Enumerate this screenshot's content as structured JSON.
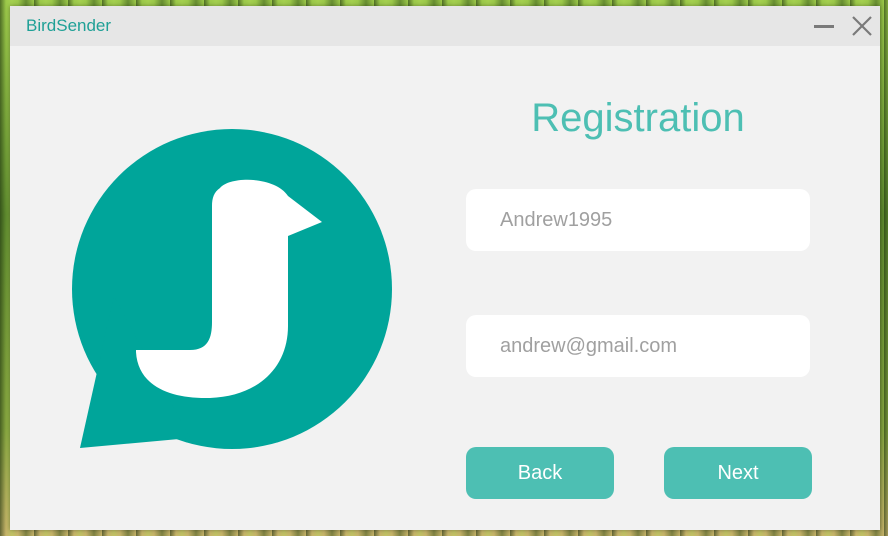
{
  "window": {
    "title": "BirdSender",
    "minimize_icon": "minimize-icon",
    "close_icon": "close-icon"
  },
  "logo": {
    "icon": "bird-chat-bubble-icon",
    "color": "#00a59a"
  },
  "form": {
    "heading": "Registration",
    "username_value": "Andrew1995",
    "email_value": "andrew@gmail.com",
    "back_label": "Back",
    "next_label": "Next"
  },
  "colors": {
    "accent": "#4dbfb3",
    "title_text": "#1fa096",
    "window_bg": "#f2f2f2",
    "titlebar_bg": "#e6e6e6"
  }
}
